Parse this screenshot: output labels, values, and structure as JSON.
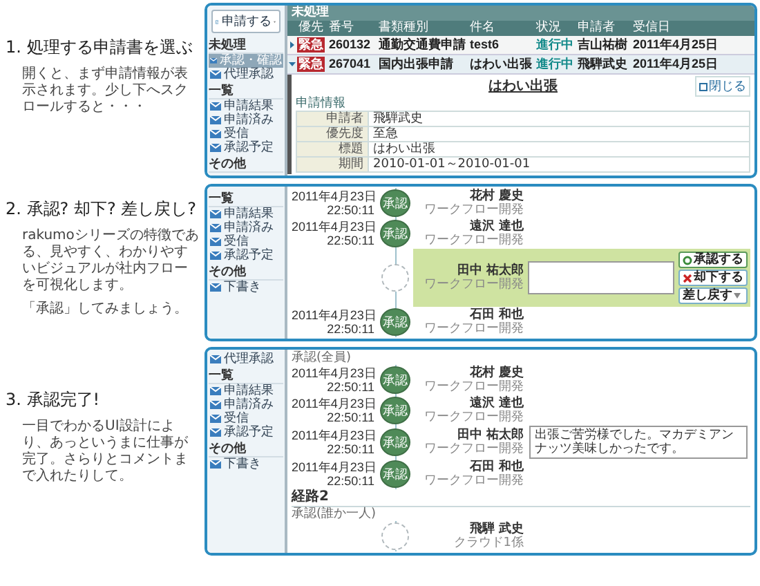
{
  "steps": [
    {
      "title": "1. 処理する申請書を選ぶ",
      "paragraphs": [
        "開くと、まず申請情報が表示されます。少し下へスクロールすると・・・"
      ]
    },
    {
      "title": "2. 承認? 却下? 差し戻し?",
      "paragraphs": [
        "rakumoシリーズの特徴である、見やすく、わかりやすいビジュアルが社内フローを可視化します。",
        "「承認」してみましょう。"
      ]
    },
    {
      "title": "3. 承認完了!",
      "paragraphs": [
        "一目でわかるUI設計により、あっというまに仕事が完了。さらりとコメントまで入れたりして。"
      ]
    }
  ],
  "screens": [
    {
      "kind": "inbox",
      "sidebar": {
        "button": "申請する",
        "sections": [
          {
            "title": "未処理",
            "items": [
              {
                "label": "承認・確認",
                "selected": true
              },
              {
                "label": "代理承認",
                "selected": false
              }
            ]
          },
          {
            "title": "一覧",
            "items": [
              {
                "label": "申請結果",
                "selected": false
              },
              {
                "label": "申請済み",
                "selected": false
              },
              {
                "label": "受信",
                "selected": false
              },
              {
                "label": "承認予定",
                "selected": false
              }
            ]
          },
          {
            "title": "その他"
          }
        ]
      },
      "header": "未処理",
      "columns": [
        "優先",
        "番号",
        "書類種別",
        "件名",
        "状況",
        "申請者",
        "受信日"
      ],
      "rows": [
        {
          "expanded": false,
          "cells": [
            "緊急",
            "260132",
            "通勤交通費申請",
            "test6",
            "進行中",
            "吉山祐樹",
            "2011年4月25日"
          ]
        },
        {
          "expanded": true,
          "cells": [
            "緊急",
            "267041",
            "国内出張申請",
            "はわい出張",
            "進行中",
            "飛騨武史",
            "2011年4月25日"
          ]
        }
      ],
      "detail": {
        "close": "閉じる",
        "title": "はわい出張",
        "section": "申請情報",
        "fields": [
          {
            "label": "申請者",
            "value": "飛騨武史"
          },
          {
            "label": "優先度",
            "value": "至急"
          },
          {
            "label": "標題",
            "value": "はわい出張"
          },
          {
            "label": "期間",
            "value": "2010-01-01～2010-01-01"
          }
        ]
      }
    },
    {
      "kind": "flow",
      "sidebar": {
        "sections": [
          {
            "title": "一覧",
            "items": [
              {
                "label": "申請結果",
                "selected": false
              },
              {
                "label": "申請済み",
                "selected": false
              },
              {
                "label": "受信",
                "selected": false
              },
              {
                "label": "承認予定",
                "selected": false
              }
            ]
          },
          {
            "title": "その他",
            "items": [
              {
                "label": "下書き",
                "selected": false
              }
            ]
          }
        ]
      },
      "entries": [
        {
          "kind": "approved",
          "date": "2011年4月23日",
          "time": "22:50:11",
          "stamp": "承認",
          "name": "花村 慶史",
          "role": "ワークフロー開発"
        },
        {
          "kind": "approved",
          "date": "2011年4月23日",
          "time": "22:50:11",
          "stamp": "承認",
          "name": "遠沢 達也",
          "role": "ワークフロー開発"
        },
        {
          "kind": "current",
          "name": "田中 祐太郎",
          "role": "ワークフロー開発",
          "actions": [
            {
              "kind": "approve",
              "label": "承認する"
            },
            {
              "kind": "reject",
              "label": "却下する"
            },
            {
              "kind": "return",
              "label": "差し戻す"
            }
          ]
        },
        {
          "kind": "approved",
          "date": "2011年4月23日",
          "time": "22:50:11",
          "stamp": "承認",
          "name": "石田 和也",
          "role": "ワークフロー開発"
        }
      ]
    },
    {
      "kind": "flow",
      "sidebar": {
        "sections": [
          {
            "items": [
              {
                "label": "代理承認",
                "selected": false
              }
            ]
          },
          {
            "title": "一覧",
            "items": [
              {
                "label": "申請結果",
                "selected": false
              },
              {
                "label": "申請済み",
                "selected": false
              },
              {
                "label": "受信",
                "selected": false
              },
              {
                "label": "承認予定",
                "selected": false
              }
            ]
          },
          {
            "title": "その他",
            "items": [
              {
                "label": "下書き",
                "selected": false
              }
            ]
          }
        ]
      },
      "route_label": "承認(全員)",
      "entries": [
        {
          "kind": "approved",
          "date": "2011年4月23日",
          "time": "22:50:11",
          "stamp": "承認",
          "name": "花村 慶史",
          "role": "ワークフロー開発"
        },
        {
          "kind": "approved",
          "date": "2011年4月23日",
          "time": "22:50:11",
          "stamp": "承認",
          "name": "遠沢 達也",
          "role": "ワークフロー開発"
        },
        {
          "kind": "approved",
          "date": "2011年4月23日",
          "time": "22:50:11",
          "stamp": "承認",
          "name": "田中 祐太郎",
          "role": "ワークフロー開発",
          "comment": "出張ご苦労様でした。マカデミアンナッツ美味しかったです。"
        },
        {
          "kind": "approved",
          "date": "2011年4月23日",
          "time": "22:50:11",
          "stamp": "承認",
          "name": "石田 和也",
          "role": "ワークフロー開発"
        }
      ],
      "route2": {
        "title": "経路2",
        "label": "承認(誰か一人)",
        "entries": [
          {
            "kind": "waiting",
            "name": "飛騨 武史",
            "role": "クラウド1係"
          }
        ]
      }
    }
  ]
}
